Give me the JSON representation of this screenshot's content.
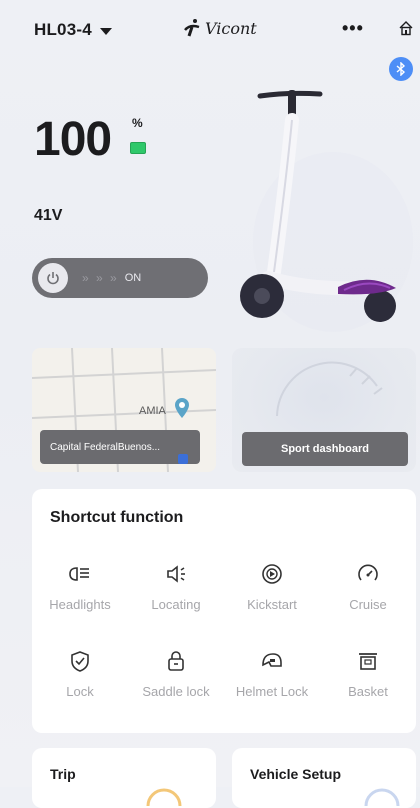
{
  "header": {
    "device_name": "HL03-4",
    "brand": "Vicont"
  },
  "status": {
    "battery_value": "100",
    "battery_unit": "%",
    "voltage": "41V",
    "power_state": "ON"
  },
  "map_card": {
    "location": "Capital FederalBuenos...",
    "place": "AMIA"
  },
  "sport_card": {
    "label": "Sport dashboard"
  },
  "shortcuts": {
    "title": "Shortcut function",
    "items": [
      {
        "label": "Headlights",
        "icon": "headlight-icon"
      },
      {
        "label": "Locating",
        "icon": "speaker-icon"
      },
      {
        "label": "Kickstart",
        "icon": "kickstart-icon"
      },
      {
        "label": "Cruise",
        "icon": "speedometer-icon"
      },
      {
        "label": "Lock",
        "icon": "shield-check-icon"
      },
      {
        "label": "Saddle lock",
        "icon": "padlock-icon"
      },
      {
        "label": "Helmet Lock",
        "icon": "helmet-icon"
      },
      {
        "label": "Basket",
        "icon": "basket-icon"
      }
    ]
  },
  "bottom_cards": {
    "trip": "Trip",
    "vehicle_setup": "Vehicle Setup"
  },
  "colors": {
    "accent_blue": "#4d8ef6",
    "battery_green": "#2fc86a",
    "pill_gray": "#6f6f74"
  }
}
